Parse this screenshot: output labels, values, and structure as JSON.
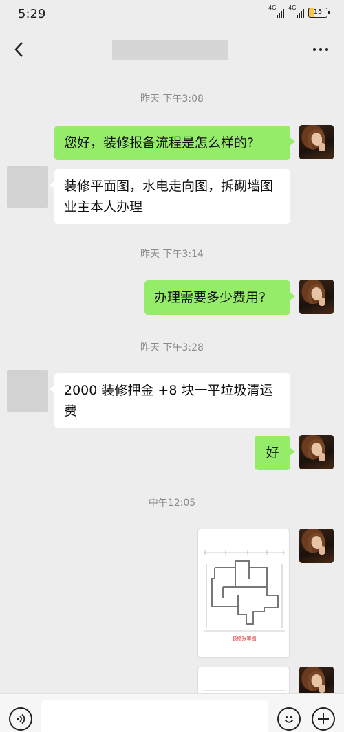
{
  "status_bar": {
    "time": "5:29",
    "signal1_label": "4G",
    "signal2_label": "4G",
    "battery": "15"
  },
  "header": {
    "title": ""
  },
  "messages": {
    "ts1": "昨天 下午3:08",
    "m1": "您好，装修报备流程是怎么样的?",
    "m2": "装修平面图，水电走向图，拆砌墙图 业主本人办理",
    "ts2": "昨天 下午3:14",
    "m3": "办理需要多少费用?",
    "ts3": "昨天 下午3:28",
    "m4": "2000 装修押金 +8 块一平垃圾清运费",
    "m5": "好",
    "ts4": "中午12:05"
  },
  "floor_plan": {
    "caption": "装修报审图"
  },
  "colors": {
    "my_bubble": "#95ec69",
    "peer_bubble": "#ffffff",
    "background": "#ededed"
  },
  "icons": {
    "back": "back-arrow-icon",
    "more": "more-dots-icon",
    "voice": "voice-icon",
    "emoji": "emoji-icon",
    "plus": "plus-icon"
  }
}
